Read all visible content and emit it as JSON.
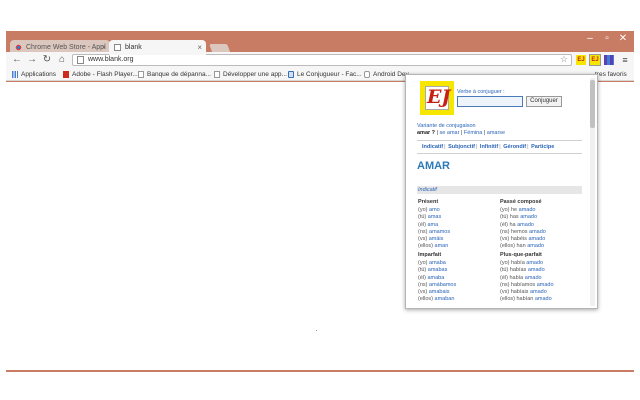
{
  "browser": {
    "tabs": [
      {
        "title": "Chrome Web Store - Appl",
        "active": false
      },
      {
        "title": "blank",
        "active": true
      }
    ],
    "address": "www.blank.org",
    "extension_label": "EJ",
    "bookmarks": [
      {
        "label": "Applications",
        "icon": "apps-grid-icon"
      },
      {
        "label": "Adobe - Flash Player...",
        "icon": "adobe-icon"
      },
      {
        "label": "Banque de dépanna...",
        "icon": "page-icon"
      },
      {
        "label": "Développer une app...",
        "icon": "page-icon"
      },
      {
        "label": "Le Conjugueur - Fac...",
        "icon": "conjugueur-icon"
      },
      {
        "label": "Android Dev",
        "icon": "android-icon"
      }
    ],
    "other_bookmarks": "tres favoris"
  },
  "popup": {
    "logo_letters": "EJ",
    "verb_label": "Verbe à conjuguer :",
    "verb_input_value": "",
    "conjugate_button": "Conjuguer",
    "variante_label": "Variante de conjugaison",
    "variante": {
      "current": "amar ?",
      "options": [
        "se amar",
        "Fémina",
        "amarse"
      ],
      "separators": "|"
    },
    "modes": [
      "Indicatif",
      "Subjonctif",
      "Infinitif",
      "Gérondif",
      "Participe"
    ],
    "verb": "AMAR",
    "mood": "Indicatif",
    "tenses": [
      {
        "name": "Présent",
        "rows": [
          {
            "p": "(yo)",
            "v": "amo"
          },
          {
            "p": "(tú)",
            "v": "amas"
          },
          {
            "p": "(él)",
            "v": "ama"
          },
          {
            "p": "(ns)",
            "v": "amamos"
          },
          {
            "p": "(vs)",
            "v": "amáis"
          },
          {
            "p": "(ellos)",
            "v": "aman"
          }
        ]
      },
      {
        "name": "Passé composé",
        "rows": [
          {
            "p": "(yo) he",
            "v": "amado"
          },
          {
            "p": "(tú) has",
            "v": "amado"
          },
          {
            "p": "(él) ha",
            "v": "amado"
          },
          {
            "p": "(ns) hemos",
            "v": "amado"
          },
          {
            "p": "(vs) habéis",
            "v": "amado"
          },
          {
            "p": "(ellos) han",
            "v": "amado"
          }
        ]
      },
      {
        "name": "Imparfait",
        "rows": [
          {
            "p": "(yo)",
            "v": "amaba"
          },
          {
            "p": "(tú)",
            "v": "amabas"
          },
          {
            "p": "(él)",
            "v": "amaba"
          },
          {
            "p": "(ns)",
            "v": "amábamos"
          },
          {
            "p": "(vs)",
            "v": "amabais"
          },
          {
            "p": "(ellos)",
            "v": "amaban"
          }
        ]
      },
      {
        "name": "Plus-que-parfait",
        "rows": [
          {
            "p": "(yo) había",
            "v": "amado"
          },
          {
            "p": "(tú) habías",
            "v": "amado"
          },
          {
            "p": "(él) había",
            "v": "amado"
          },
          {
            "p": "(ns) habíamos",
            "v": "amado"
          },
          {
            "p": "(vs) habíais",
            "v": "amado"
          },
          {
            "p": "(ellos) habían",
            "v": "amado"
          }
        ]
      }
    ]
  },
  "colors": {
    "frame": "#c87c63",
    "link": "#2a64b8",
    "logo_bg": "#f6e600",
    "logo_letter": "#c62010"
  }
}
